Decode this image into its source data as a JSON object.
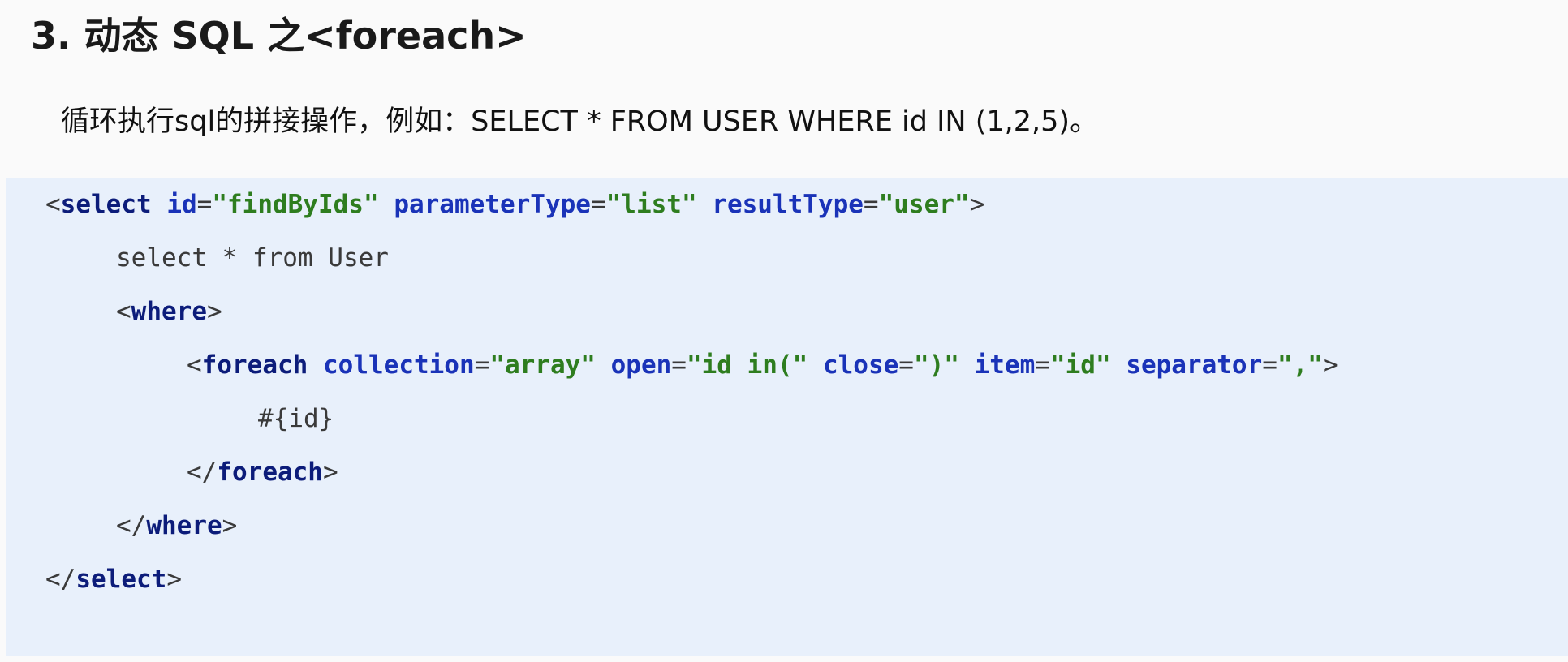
{
  "slide": {
    "title": "3. 动态 SQL  之<foreach>",
    "description": "循环执行sql的拼接操作，例如：SELECT * FROM USER WHERE id IN (1,2,5)。"
  },
  "code": {
    "select_open": {
      "lt": "<",
      "tag": "select",
      "attr1_name": "id",
      "eq1": "=",
      "attr1_value": "\"findByIds\"",
      "attr2_name": "parameterType",
      "eq2": "=",
      "attr2_value": "\"list\"",
      "attr3_name": "resultType",
      "eq3": "=",
      "attr3_value": "\"user\"",
      "gt": ">"
    },
    "sql_text": "select * from User",
    "where_open": {
      "lt": "<",
      "tag": "where",
      "gt": ">"
    },
    "foreach_open": {
      "lt": "<",
      "tag": "foreach",
      "attr1_name": "collection",
      "eq1": "=",
      "attr1_value": "\"array\"",
      "attr2_name": "open",
      "eq2": "=",
      "attr2_value": "\"id in(\"",
      "attr3_name": "close",
      "eq3": "=",
      "attr3_value": "\")\"",
      "attr4_name": "item",
      "eq4": "=",
      "attr4_value": "\"id\"",
      "attr5_name": "separator",
      "eq5": "=",
      "attr5_value": "\",\"",
      "gt": ">"
    },
    "item_expr": "#{id}",
    "foreach_close": {
      "lt": "</",
      "tag": "foreach",
      "gt": ">"
    },
    "where_close": {
      "lt": "</",
      "tag": "where",
      "gt": ">"
    },
    "select_close": {
      "lt": "</",
      "tag": "select",
      "gt": ">"
    }
  }
}
